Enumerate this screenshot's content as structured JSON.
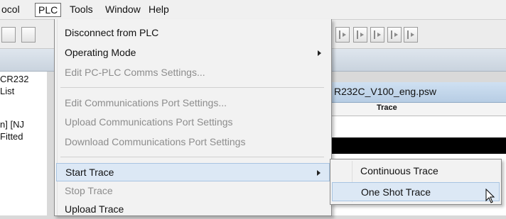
{
  "menubar": {
    "items": [
      {
        "label": "ocol"
      },
      {
        "label": "PLC"
      },
      {
        "label": "Tools"
      },
      {
        "label": "Window"
      },
      {
        "label": "Help"
      }
    ]
  },
  "left_panel": {
    "lines": [
      "CR232",
      "List",
      "n] [NJ",
      "Fitted"
    ]
  },
  "document": {
    "tab_title": "R232C_V100_eng.psw",
    "column_header": "Trace"
  },
  "plc_menu": {
    "items": [
      {
        "label": "Disconnect from PLC",
        "enabled": true,
        "submenu": false
      },
      {
        "label": "Operating Mode",
        "enabled": true,
        "submenu": true
      },
      {
        "label": "Edit PC-PLC Comms Settings...",
        "enabled": false,
        "submenu": false
      },
      {
        "label": "Edit Communications Port Settings...",
        "enabled": false,
        "submenu": false
      },
      {
        "label": "Upload Communications Port Settings",
        "enabled": false,
        "submenu": false
      },
      {
        "label": "Download Communications Port Settings",
        "enabled": false,
        "submenu": false
      },
      {
        "label": "Start Trace",
        "enabled": true,
        "submenu": true,
        "highlighted": true
      },
      {
        "label": "Stop Trace",
        "enabled": false,
        "submenu": false
      },
      {
        "label": "Upload Trace",
        "enabled": true,
        "submenu": false
      }
    ]
  },
  "trace_submenu": {
    "items": [
      {
        "label": "Continuous Trace",
        "highlighted": false
      },
      {
        "label": "One Shot Trace",
        "highlighted": true
      }
    ]
  },
  "icons": {
    "toolbar_buttons": "step-play-icon",
    "submenu_arrow": "chevron-right-icon",
    "mouse_cursor": "pointer-cursor-icon"
  },
  "colors": {
    "highlight_bg": "#dce8f5",
    "highlight_border": "#a8c4e2",
    "disabled_text": "#8d8d8d"
  }
}
